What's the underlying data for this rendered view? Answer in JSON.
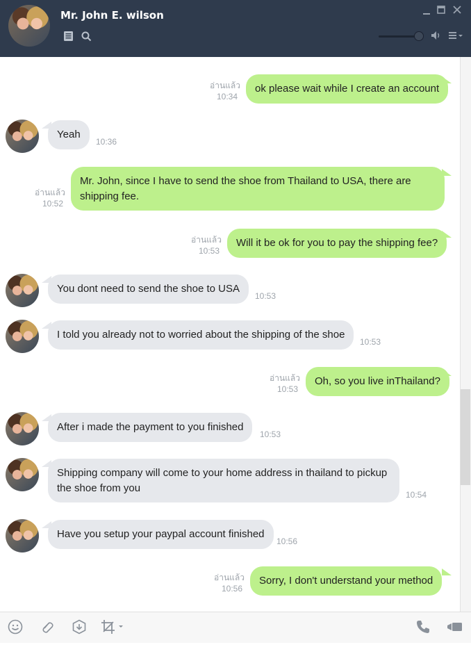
{
  "contact": {
    "name": "Mr. John E. wilson"
  },
  "messages": [
    {
      "dir": "out",
      "text": "ok please wait while I create an account",
      "read": "อ่านแล้ว",
      "time": "10:34"
    },
    {
      "dir": "in",
      "text": "Yeah",
      "time": "10:36"
    },
    {
      "dir": "out",
      "text": "Mr. John, since I have to send the shoe from Thailand to USA, there are shipping fee.",
      "read": "อ่านแล้ว",
      "time": "10:52"
    },
    {
      "dir": "out",
      "text": "Will it be ok for you to pay the shipping fee?",
      "read": "อ่านแล้ว",
      "time": "10:53"
    },
    {
      "dir": "in",
      "text": "You dont need to send the shoe to USA",
      "time": "10:53"
    },
    {
      "dir": "in",
      "text": "I told you already not to worried about the shipping of the shoe",
      "time": "10:53"
    },
    {
      "dir": "out",
      "text": "Oh, so you live inThailand?",
      "read": "อ่านแล้ว",
      "time": "10:53"
    },
    {
      "dir": "in",
      "text": "After i made the payment to you finished",
      "time": "10:53"
    },
    {
      "dir": "in",
      "text": "Shipping company will come to your home address in thailand to pickup the shoe from you",
      "time": "10:54"
    },
    {
      "dir": "in",
      "text": "Have you setup your paypal account finished",
      "time": "10:56"
    },
    {
      "dir": "out",
      "text": "Sorry, I don't understand your method",
      "read": "อ่านแล้ว",
      "time": "10:56"
    }
  ],
  "icons": {
    "header": [
      "notes-icon",
      "search-icon",
      "minimize-icon",
      "maximize-icon",
      "close-icon",
      "volume-icon",
      "menu-icon"
    ],
    "toolbar": [
      "emoji-icon",
      "attach-icon",
      "keep-icon",
      "screenshot-icon",
      "call-icon",
      "video-call-icon"
    ]
  },
  "colors": {
    "header": "#2f3b4d",
    "outgoing": "#bdf08c",
    "incoming": "#e6e8ec"
  }
}
